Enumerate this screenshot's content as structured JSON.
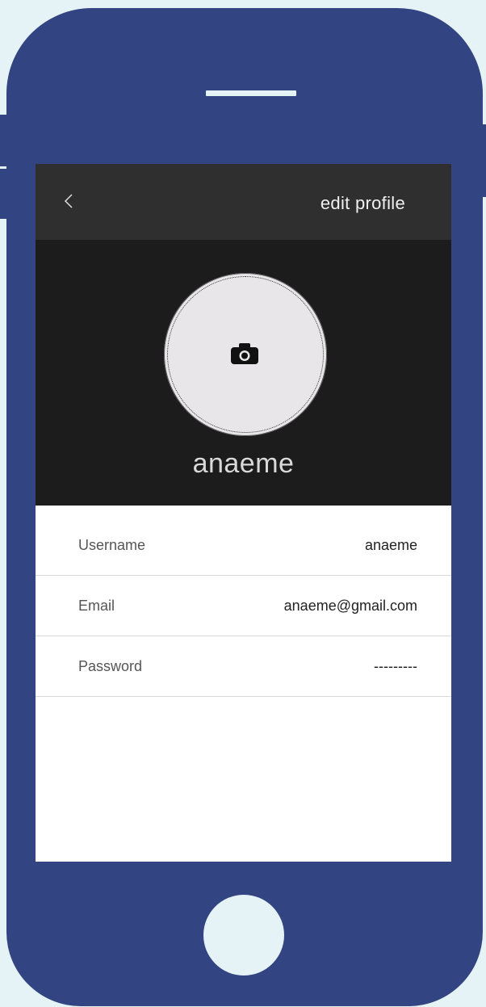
{
  "header": {
    "title": "edit profile",
    "back_icon": "chevron-left-icon"
  },
  "profile": {
    "display_name": "anaeme",
    "avatar_icon": "camera-icon"
  },
  "fields": [
    {
      "label": "Username",
      "value": "anaeme"
    },
    {
      "label": "Email",
      "value": "anaeme@gmail.com"
    },
    {
      "label": "Password",
      "value": "---------"
    }
  ],
  "colors": {
    "device": "#324482",
    "background": "#e6f3f6",
    "topbar": "#2f2f2f",
    "hero": "#1c1c1c"
  }
}
